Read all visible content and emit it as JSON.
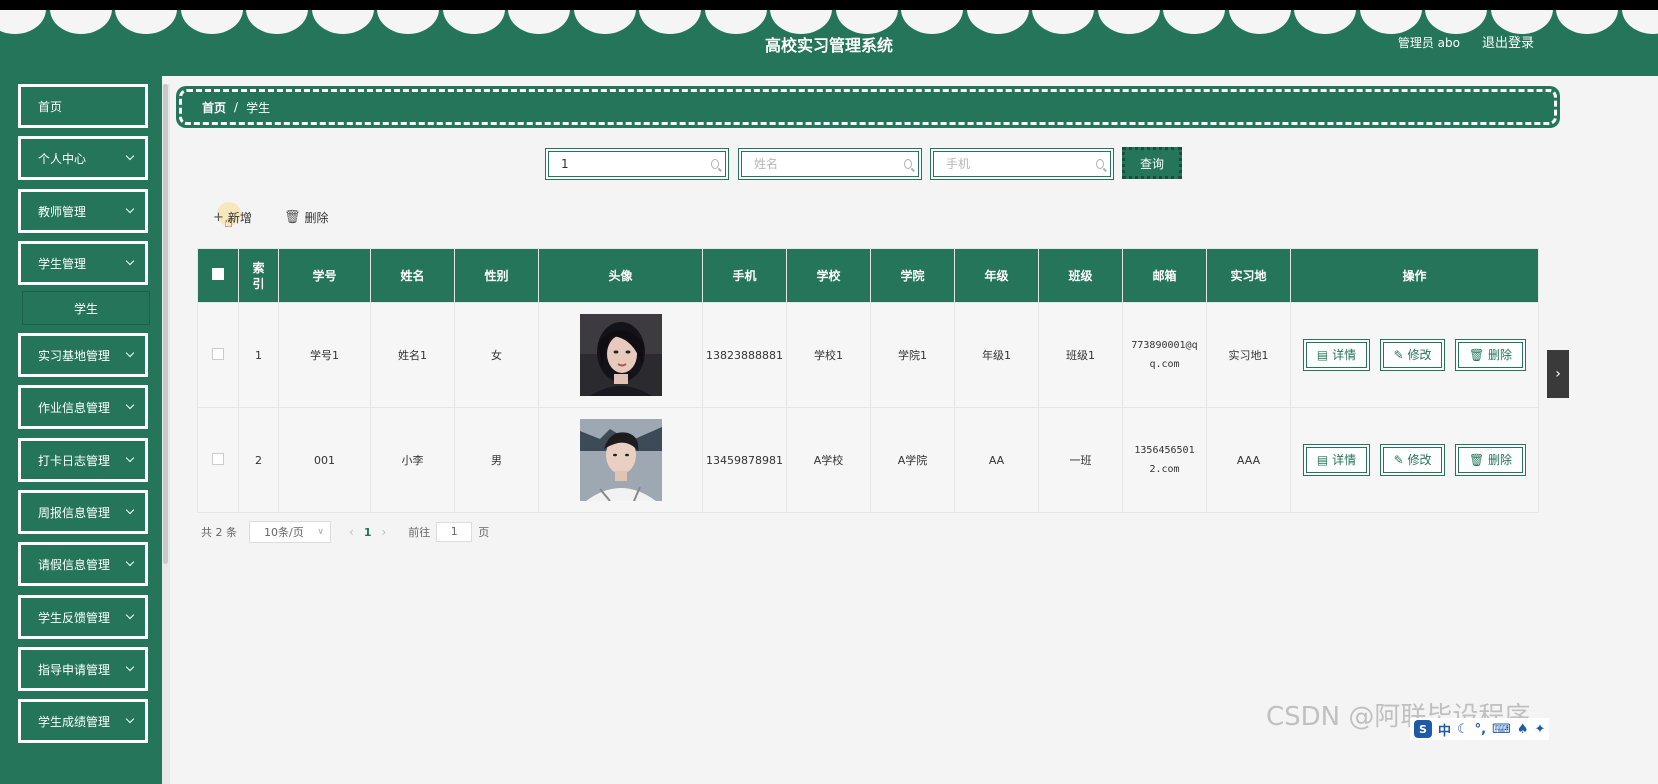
{
  "header": {
    "title": "高校实习管理系统",
    "user": "管理员 abo",
    "logout": "退出登录"
  },
  "sidebar": {
    "items": [
      {
        "label": "首页",
        "expandable": false
      },
      {
        "label": "个人中心",
        "expandable": true
      },
      {
        "label": "教师管理",
        "expandable": true
      },
      {
        "label": "学生管理",
        "expandable": true
      },
      {
        "label": "实习基地管理",
        "expandable": true
      },
      {
        "label": "作业信息管理",
        "expandable": true
      },
      {
        "label": "打卡日志管理",
        "expandable": true
      },
      {
        "label": "周报信息管理",
        "expandable": true
      },
      {
        "label": "请假信息管理",
        "expandable": true
      },
      {
        "label": "学生反馈管理",
        "expandable": true
      },
      {
        "label": "指导申请管理",
        "expandable": true
      },
      {
        "label": "学生成绩管理",
        "expandable": true
      }
    ],
    "subitem": "学生"
  },
  "breadcrumb": {
    "home": "首页",
    "separator": "/",
    "current": "学生"
  },
  "search": {
    "xuehao_value": "1",
    "xingming_placeholder": "姓名",
    "shouji_placeholder": "手机",
    "query_label": "查询"
  },
  "toolbar": {
    "add_label": "新增",
    "delete_label": "删除"
  },
  "table": {
    "headers": [
      "索引",
      "学号",
      "姓名",
      "性别",
      "头像",
      "手机",
      "学校",
      "学院",
      "年级",
      "班级",
      "邮箱",
      "实习地",
      "操作"
    ],
    "rows": [
      {
        "index": "1",
        "xuehao": "学号1",
        "xingming": "姓名1",
        "xingbie": "女",
        "shouji": "13823888881",
        "xuexiao": "学校1",
        "xueyuan": "学院1",
        "nianji": "年级1",
        "banji": "班级1",
        "youxiang": "773890001@qq.com",
        "shixidi": "实习地1"
      },
      {
        "index": "2",
        "xuehao": "001",
        "xingming": "小李",
        "xingbie": "男",
        "shouji": "13459878981",
        "xuexiao": "A学校",
        "xueyuan": "A学院",
        "nianji": "AA",
        "banji": "一班",
        "youxiang": "13564565012.com",
        "shixidi": "AAA"
      }
    ],
    "actions": {
      "detail": "详情",
      "edit": "修改",
      "delete": "删除"
    }
  },
  "pagination": {
    "total": "共 2 条",
    "page_size": "10条/页",
    "current_page": "1",
    "goto_label": "前往",
    "goto_value": "1",
    "page_suffix": "页"
  },
  "watermark": "CSDN @阿联毕设程序",
  "ime": {
    "lang": "中"
  },
  "colors": {
    "primary": "#24755a",
    "background": "#f4f4f4"
  }
}
